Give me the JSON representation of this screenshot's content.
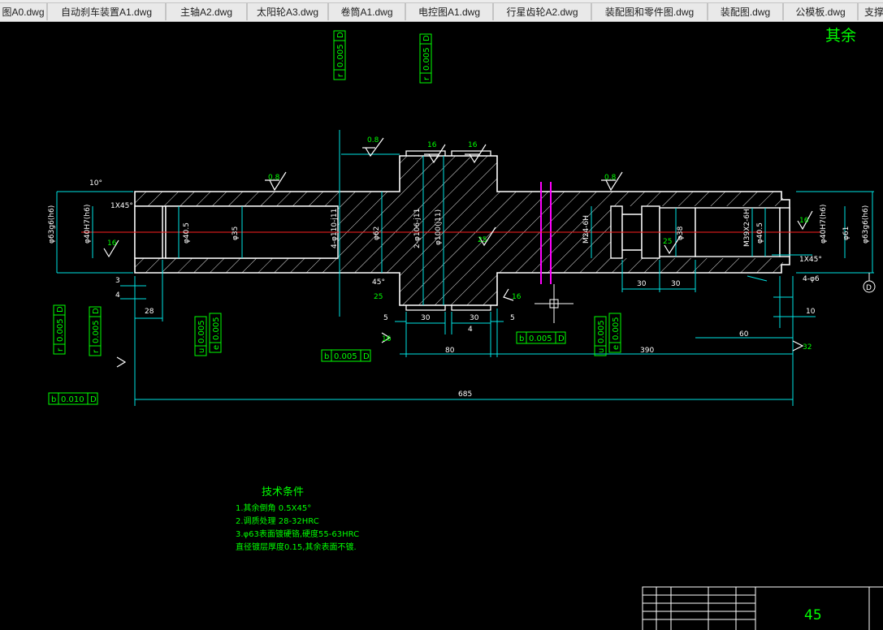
{
  "window": {
    "tabs": [
      {
        "label": "图A0.dwg"
      },
      {
        "label": "自动刹车装置A1.dwg"
      },
      {
        "label": "主轴A2.dwg"
      },
      {
        "label": "太阳轮A3.dwg"
      },
      {
        "label": "卷筒A1.dwg"
      },
      {
        "label": "电控图A1.dwg"
      },
      {
        "label": "行星齿轮A2.dwg"
      },
      {
        "label": "装配图和零件图.dwg"
      },
      {
        "label": "装配图.dwg"
      },
      {
        "label": "公模板.dwg"
      },
      {
        "label": "支撑"
      }
    ]
  },
  "drawing": {
    "surface_note": "其余",
    "colors": {
      "background": "#000000",
      "outline": "#ffffff",
      "dimension": "#00e5e5",
      "annotation": "#00ff00",
      "centerline": "#ff2020",
      "keyway": "#ff00ff"
    },
    "roughness": [
      "0.8",
      "16",
      "16",
      "0.8",
      "0.8",
      "16",
      "25",
      "25",
      "16",
      "25",
      "16",
      "16",
      "32"
    ],
    "diameters": [
      "φ63g6(h6)",
      "φ40H7(h6)",
      "φ40.5",
      "φ35",
      "4-φ110-j11",
      "φ62",
      "2-φ106-j11",
      "φ100(j11)",
      "M24-6H",
      "φ38",
      "M39X2-6H",
      "φ40.5",
      "φ40H7(h6)",
      "φ61",
      "φ63g6(h6)"
    ],
    "dimensions": [
      "10°",
      "3",
      "4",
      "28",
      "5",
      "30",
      "30",
      "5",
      "4",
      "80",
      "390",
      "60",
      "30",
      "30",
      "4-φ6",
      "10",
      "45°",
      "685",
      "1X45°",
      "1X45°"
    ],
    "tolerance_frames": [
      {
        "sym": "r",
        "val": "0.005",
        "dat": "D"
      },
      {
        "sym": "r",
        "val": "0.005",
        "dat": "D"
      },
      {
        "sym": "r",
        "val": "0.005",
        "dat": "D"
      },
      {
        "sym": "r",
        "val": "0.005",
        "dat": "D"
      },
      {
        "sym": "u",
        "val": "0.005",
        "dat": ""
      },
      {
        "sym": "e",
        "val": "0.005",
        "dat": ""
      },
      {
        "sym": "b",
        "val": "0.005",
        "dat": "D"
      },
      {
        "sym": "b",
        "val": "0.005",
        "dat": "D"
      },
      {
        "sym": "u",
        "val": "0.005",
        "dat": ""
      },
      {
        "sym": "e",
        "val": "0.005",
        "dat": ""
      },
      {
        "sym": "b",
        "val": "0.010",
        "dat": "D"
      }
    ],
    "datum_label": "D",
    "tech_title": "技术条件",
    "tech_lines": [
      "1.其余倒角 0.5X45°",
      "2.调质处理  28-32HRC",
      "3.φ63表面镀硬铬,硬度55-63HRC",
      "   直径镀层厚度0.15,其余表面不镀."
    ],
    "material": "45"
  }
}
